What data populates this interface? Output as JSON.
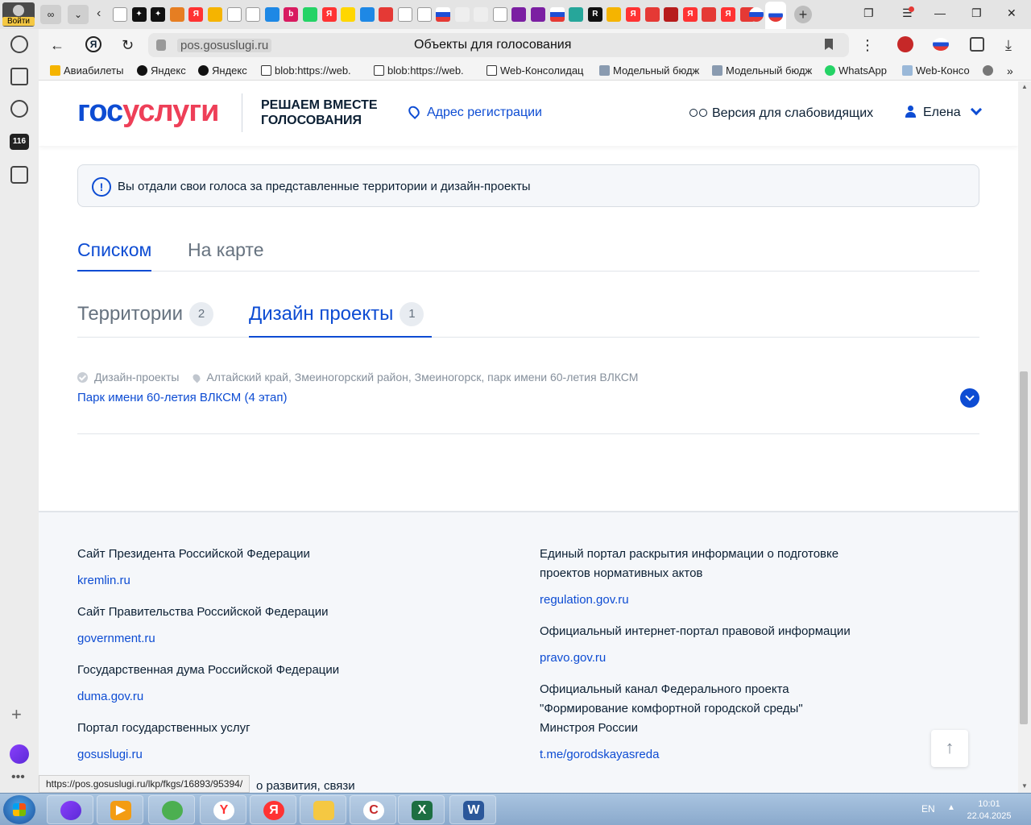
{
  "browser": {
    "login_label": "Войти",
    "url_host": "pos.gosuslugi.ru",
    "page_title": "Объекты для голосования",
    "bookmarks": [
      {
        "label": "Авиабилеты",
        "color": "#f5b400"
      },
      {
        "label": "Яндекс",
        "color": "#111111"
      },
      {
        "label": "Яндекс",
        "color": "#111111"
      },
      {
        "label": "blob:https://web.",
        "color": "#ffffff"
      },
      {
        "label": "blob:https://web.",
        "color": "#ffffff"
      },
      {
        "label": "Web-Консолидац",
        "color": "#ffffff"
      },
      {
        "label": "Модельный бюдж",
        "color": "#8a9bb0"
      },
      {
        "label": "Модельный бюдж",
        "color": "#8a9bb0"
      },
      {
        "label": "WhatsApp",
        "color": "#25d366"
      },
      {
        "label": "Web-Консо",
        "color": "#9ab8d8"
      }
    ],
    "status_url": "https://pos.gosuslugi.ru/lkp/fkgs/16893/95394/"
  },
  "header": {
    "logo_part1": "гос",
    "logo_part2": "услуги",
    "slogan_line1": "РЕШАЕМ ВМЕСТЕ",
    "slogan_line2": "ГОЛОСОВАНИЯ",
    "address_link": "Адрес регистрации",
    "vision_link": "Версия для слабовидящих",
    "user_name": "Елена"
  },
  "info": {
    "text": "Вы отдали свои голоса за представленные территории и дизайн-проекты"
  },
  "view_tabs": [
    {
      "label": "Списком",
      "active": true
    },
    {
      "label": "На карте",
      "active": false
    }
  ],
  "type_tabs": [
    {
      "label": "Территории",
      "count": "2",
      "active": false
    },
    {
      "label": "Дизайн проекты",
      "count": "1",
      "active": true
    }
  ],
  "project": {
    "category": "Дизайн-проекты",
    "location": "Алтайский край, Змеиногорский район, Змеиногорск, парк имени 60-летия ВЛКСМ",
    "title": "Парк имени 60-летия ВЛКСМ (4 этап)"
  },
  "footer": {
    "left": [
      {
        "title": "Сайт Президента Российской Федерации",
        "link": "kremlin.ru"
      },
      {
        "title": "Сайт Правительства Российской Федерации",
        "link": "government.ru"
      },
      {
        "title": "Государственная дума Российской Федерации",
        "link": "duma.gov.ru"
      },
      {
        "title": "Портал государственных услуг",
        "link": "gosuslugi.ru"
      }
    ],
    "left_partial": "о развития, связи",
    "right": [
      {
        "title_line1": "Единый портал раскрытия информации о подготовке",
        "title_line2": "проектов нормативных актов",
        "link": "regulation.gov.ru"
      },
      {
        "title_line1": "Официальный интернет-портал правовой информации",
        "link": "pravo.gov.ru"
      },
      {
        "title_line1": "Официальный канал Федерального проекта",
        "title_line2": "\"Формирование комфортной городской среды\"",
        "title_line3": "Минстроя России",
        "link": "t.me/gorodskayasreda"
      }
    ],
    "to_top": "↑"
  },
  "taskbar": {
    "lang": "EN",
    "time": "10:01",
    "date": "22.04.2025"
  },
  "colors": {
    "brand_blue": "#0d4cd3",
    "brand_red": "#ee3f58",
    "text_dark": "#0b1f33",
    "text_muted": "#66727f"
  }
}
